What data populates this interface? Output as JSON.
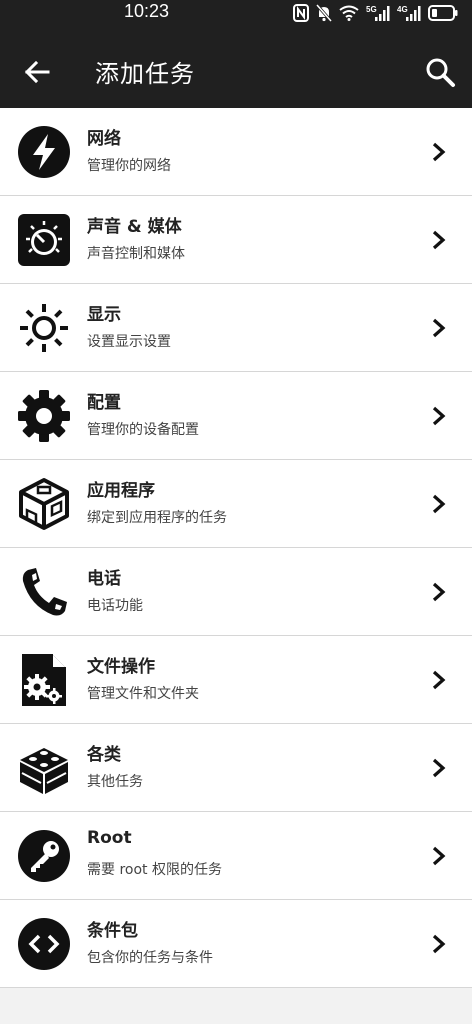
{
  "status": {
    "time": "10:23",
    "net1": "5G",
    "net2": "4G"
  },
  "header": {
    "title": "添加任务"
  },
  "items": [
    {
      "title": "网络",
      "subtitle": "管理你的网络",
      "icon": "lightning-icon"
    },
    {
      "title": "声音 & 媒体",
      "subtitle": "声音控制和媒体",
      "icon": "volume-knob-icon"
    },
    {
      "title": "显示",
      "subtitle": "设置显示设置",
      "icon": "brightness-icon"
    },
    {
      "title": "配置",
      "subtitle": "管理你的设备配置",
      "icon": "gear-icon"
    },
    {
      "title": "应用程序",
      "subtitle": "绑定到应用程序的任务",
      "icon": "app-box-icon"
    },
    {
      "title": "电话",
      "subtitle": "电话功能",
      "icon": "phone-icon"
    },
    {
      "title": "文件操作",
      "subtitle": "管理文件和文件夹",
      "icon": "file-gears-icon"
    },
    {
      "title": "各类",
      "subtitle": "其他任务",
      "icon": "brick-icon"
    },
    {
      "title": "Root",
      "subtitle": "需要 root 权限的任务",
      "icon": "key-icon"
    },
    {
      "title": "条件包",
      "subtitle": "包含你的任务与条件",
      "icon": "code-icon"
    }
  ]
}
